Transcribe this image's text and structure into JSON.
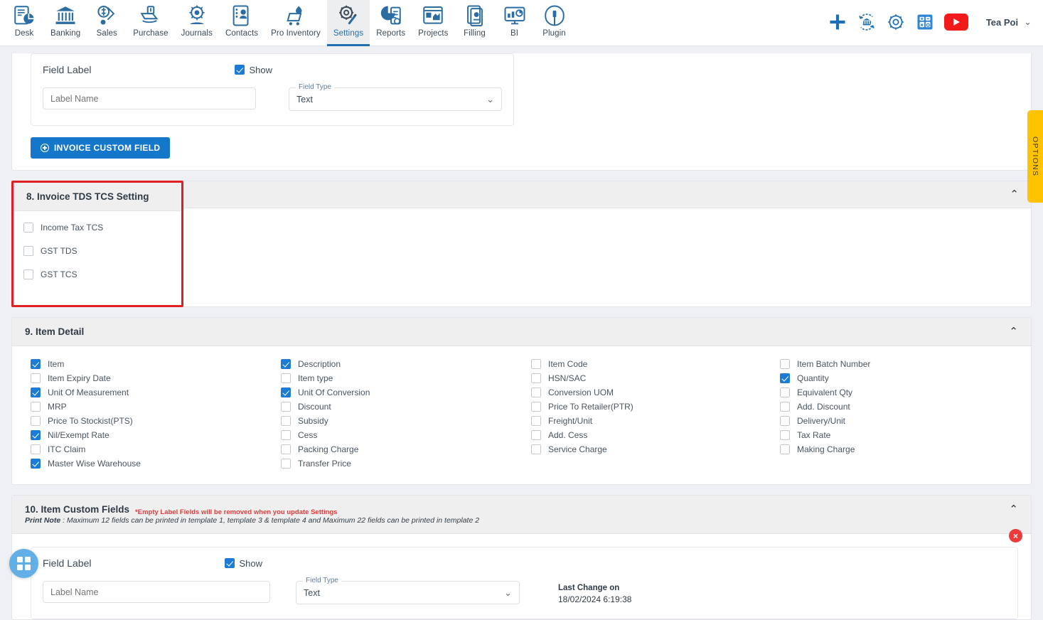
{
  "nav": {
    "items": [
      {
        "label": "Desk",
        "icon": "desk-icon",
        "active": false
      },
      {
        "label": "Banking",
        "icon": "bank-icon",
        "active": false
      },
      {
        "label": "Sales",
        "icon": "sales-icon",
        "active": false
      },
      {
        "label": "Purchase",
        "icon": "purchase-icon",
        "active": false
      },
      {
        "label": "Journals",
        "icon": "journals-icon",
        "active": false
      },
      {
        "label": "Contacts",
        "icon": "contacts-icon",
        "active": false
      },
      {
        "label": "Pro Inventory",
        "icon": "inventory-icon",
        "active": false
      },
      {
        "label": "Settings",
        "icon": "settings-icon",
        "active": true
      },
      {
        "label": "Reports",
        "icon": "reports-icon",
        "active": false
      },
      {
        "label": "Projects",
        "icon": "projects-icon",
        "active": false
      },
      {
        "label": "Filling",
        "icon": "filling-icon",
        "active": false
      },
      {
        "label": "BI",
        "icon": "bi-icon",
        "active": false
      },
      {
        "label": "Plugin",
        "icon": "plugin-icon",
        "active": false
      }
    ],
    "right_icons": [
      "plus-icon",
      "bank-sync-icon",
      "gear-icon",
      "calculator-icon",
      "youtube-icon"
    ],
    "user": "Tea Poi",
    "accent_blue": "#1477ca",
    "active_underline": "#1f6fb2"
  },
  "invoice_custom_field": {
    "field_label": "Field Label",
    "show_label": "Show",
    "show_checked": true,
    "label_placeholder": "Label Name",
    "label_value": "",
    "field_type_legend": "Field Type",
    "field_type_value": "Text",
    "remove_icon": "close-icon",
    "add_button": "INVOICE CUSTOM FIELD"
  },
  "section8": {
    "title": "8. Invoice TDS TCS Setting",
    "collapse_icon": "chevron-up-icon",
    "highlight_color": "#e02020",
    "options": [
      {
        "label": "Income Tax TCS",
        "checked": false
      },
      {
        "label": "GST TDS",
        "checked": false
      },
      {
        "label": "GST TCS",
        "checked": false
      }
    ]
  },
  "section9": {
    "title": "9. Item Detail",
    "collapse_icon": "chevron-up-icon",
    "columns": [
      [
        {
          "label": "Item",
          "checked": true
        },
        {
          "label": "Item Expiry Date",
          "checked": false
        },
        {
          "label": "Unit Of Measurement",
          "checked": true
        },
        {
          "label": "MRP",
          "checked": false
        },
        {
          "label": "Price To Stockist(PTS)",
          "checked": false
        },
        {
          "label": "Nil/Exempt Rate",
          "checked": true
        },
        {
          "label": "ITC Claim",
          "checked": false
        },
        {
          "label": "Master Wise Warehouse",
          "checked": true
        }
      ],
      [
        {
          "label": "Description",
          "checked": true
        },
        {
          "label": "Item type",
          "checked": false
        },
        {
          "label": "Unit Of Conversion",
          "checked": true
        },
        {
          "label": "Discount",
          "checked": false
        },
        {
          "label": "Subsidy",
          "checked": false
        },
        {
          "label": "Cess",
          "checked": false
        },
        {
          "label": "Packing Charge",
          "checked": false
        },
        {
          "label": "Transfer Price",
          "checked": false
        }
      ],
      [
        {
          "label": "Item Code",
          "checked": false
        },
        {
          "label": "HSN/SAC",
          "checked": false
        },
        {
          "label": "Conversion UOM",
          "checked": false
        },
        {
          "label": "Price To Retailer(PTR)",
          "checked": false
        },
        {
          "label": "Freight/Unit",
          "checked": false
        },
        {
          "label": "Add. Cess",
          "checked": false
        },
        {
          "label": "Service Charge",
          "checked": false
        }
      ],
      [
        {
          "label": "Item Batch Number",
          "checked": false
        },
        {
          "label": "Quantity",
          "checked": true
        },
        {
          "label": "Equivalent Qty",
          "checked": false
        },
        {
          "label": "Add. Discount",
          "checked": false
        },
        {
          "label": "Delivery/Unit",
          "checked": false
        },
        {
          "label": "Tax Rate",
          "checked": false
        },
        {
          "label": "Making Charge",
          "checked": false
        }
      ]
    ]
  },
  "section10": {
    "title": "10. Item Custom Fields",
    "warning": "*Empty Label Fields will be removed when you update Settings",
    "print_note_label": "Print Note",
    "print_note": " : Maximum 12 fields can be printed in template 1, template 3 & template 4 and Maximum 22 fields can be printed in template 2",
    "collapse_icon": "chevron-up-icon",
    "field_label": "Field Label",
    "show_label": "Show",
    "show_checked": true,
    "label_placeholder": "Label Name",
    "label_value": "",
    "field_type_legend": "Field Type",
    "field_type_value": "Text",
    "remove_icon": "close-icon",
    "last_change_label": "Last Change on",
    "last_change_value": "18/02/2024 6:19:38"
  },
  "options_tab": {
    "label": "OPTIONS",
    "color": "#ffc300"
  },
  "fab": {
    "icon": "grid-apps-icon"
  }
}
